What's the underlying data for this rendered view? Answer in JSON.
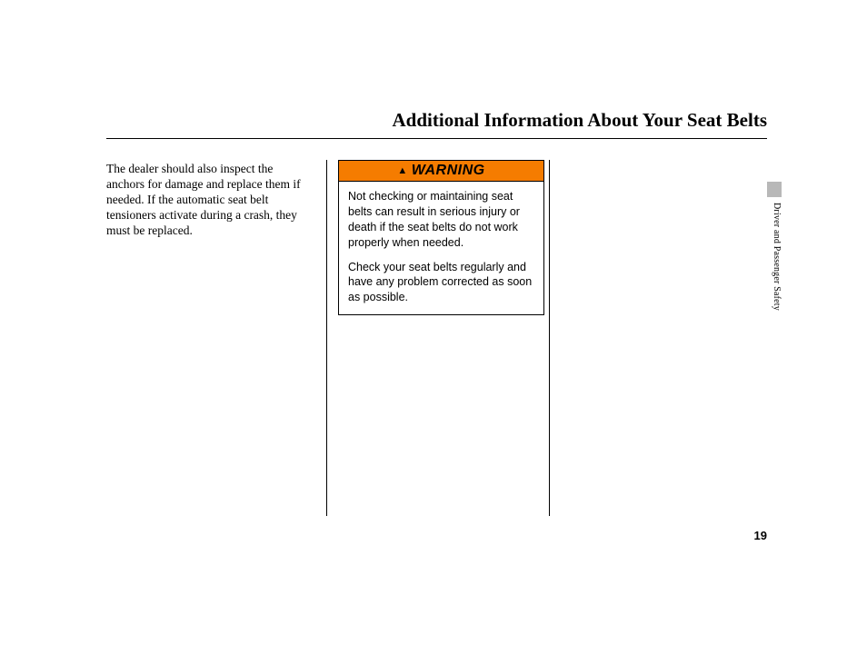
{
  "header": {
    "title": "Additional Information About Your Seat Belts"
  },
  "body": {
    "paragraph": "The dealer should also inspect the anchors for damage and replace them if needed. If the automatic seat belt tensioners activate during a crash, they must be replaced."
  },
  "warning": {
    "label": "WARNING",
    "para1": "Not checking or maintaining seat belts can result in serious injury or death if the seat belts do not work properly when needed.",
    "para2": "Check your seat belts regularly and have any problem corrected as soon as possible."
  },
  "side": {
    "section": "Driver and Passenger Safety"
  },
  "footer": {
    "page": "19"
  }
}
